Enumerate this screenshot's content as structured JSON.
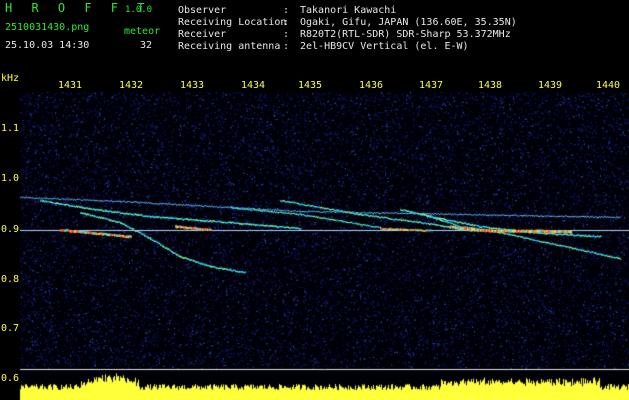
{
  "header": {
    "app_title": "H R O F F T",
    "app_version": "1.0.0",
    "file_name": "2510031430.png",
    "datetime": "25.10.03 14:30",
    "meteor_label": "meteor",
    "meteor_count": "32"
  },
  "info": [
    {
      "label": "Observer",
      "sep": ":",
      "value": "Takanori Kawachi"
    },
    {
      "label": "Receiving Location",
      "sep": ":",
      "value": "Ogaki, Gifu, JAPAN (136.60E, 35.35N)"
    },
    {
      "label": "Receiver",
      "sep": ":",
      "value": "R820T2(RTL-SDR) SDR-Sharp 53.372MHz"
    },
    {
      "label": "Receiving antenna",
      "sep": ":",
      "value": "2el-HB9CV Vertical (el. E-W)"
    }
  ],
  "axes": {
    "y_unit": "kHz",
    "x_ticks": [
      "1431",
      "1432",
      "1433",
      "1434",
      "1435",
      "1436",
      "1437",
      "1438",
      "1439",
      "1440"
    ],
    "y_ticks": [
      "1.1",
      "1.0",
      "0.9",
      "0.8",
      "0.7",
      "0.6"
    ]
  },
  "colors": {
    "background": "#000000",
    "header_text": "#2ee82e",
    "info_text": "#e8e8e8",
    "axis_text": "#ffff3a",
    "noise_floor": "#1a1a6e",
    "level_bar": "#ffff3a",
    "level_base": "#22c7ff"
  }
}
